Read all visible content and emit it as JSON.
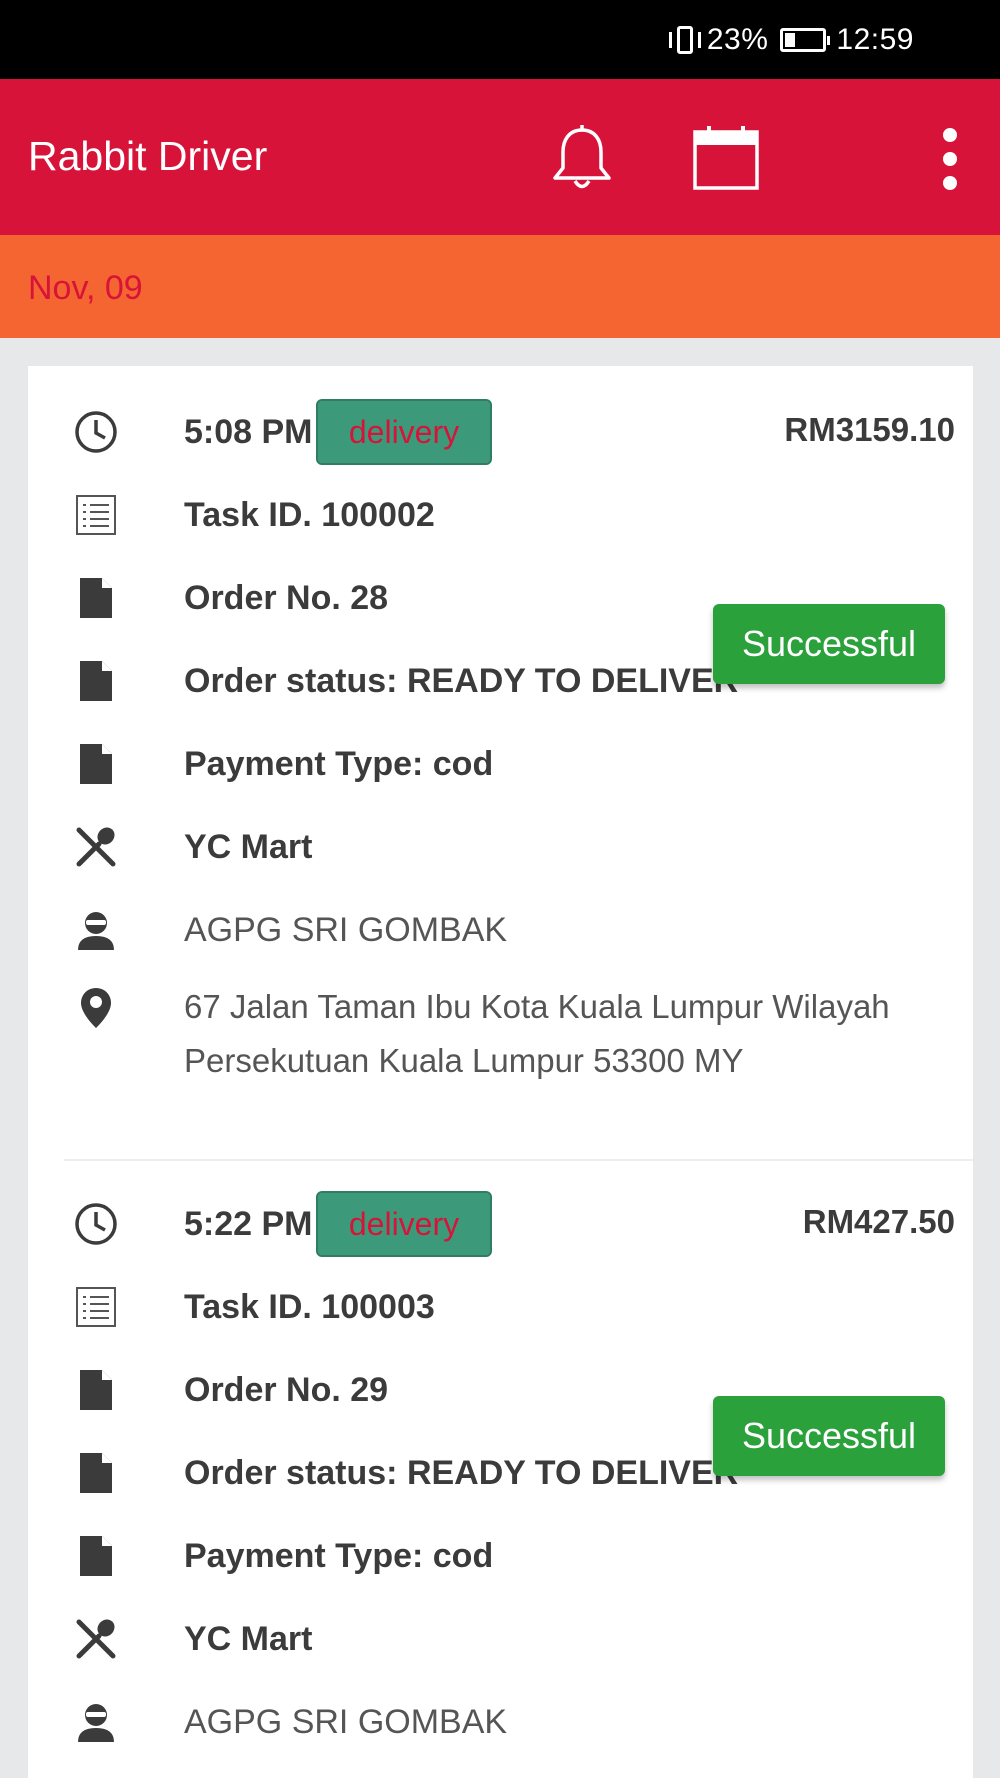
{
  "status_bar": {
    "battery": "23%",
    "time": "12:59"
  },
  "app_bar": {
    "title": "Rabbit Driver",
    "icons": [
      "bell-icon",
      "calendar-icon",
      "more-vert-icon"
    ]
  },
  "date_header": "Nov, 09",
  "colors": {
    "app_bar": "#d8133a",
    "date_bar": "#f46531",
    "badge": "#3c9a7a",
    "status_button": "#2aa13b"
  },
  "tasks": [
    {
      "time": "5:08 PM",
      "type": "delivery",
      "amount": "RM3159.10",
      "task_id": "Task ID. 100002",
      "order_no": "Order No. 28",
      "order_status": "Order status: READY TO DELIVER",
      "payment_type": "Payment Type: cod",
      "merchant": "YC Mart",
      "customer": "AGPG SRI GOMBAK",
      "address": "67 Jalan Taman Ibu Kota Kuala Lumpur Wilayah Persekutuan Kuala Lumpur 53300 MY",
      "status_button": "Successful"
    },
    {
      "time": "5:22 PM",
      "type": "delivery",
      "amount": "RM427.50",
      "task_id": "Task ID. 100003",
      "order_no": "Order No. 29",
      "order_status": "Order status: READY TO DELIVER",
      "payment_type": "Payment Type: cod",
      "merchant": "YC Mart",
      "customer": "AGPG SRI GOMBAK",
      "status_button": "Successful"
    }
  ]
}
